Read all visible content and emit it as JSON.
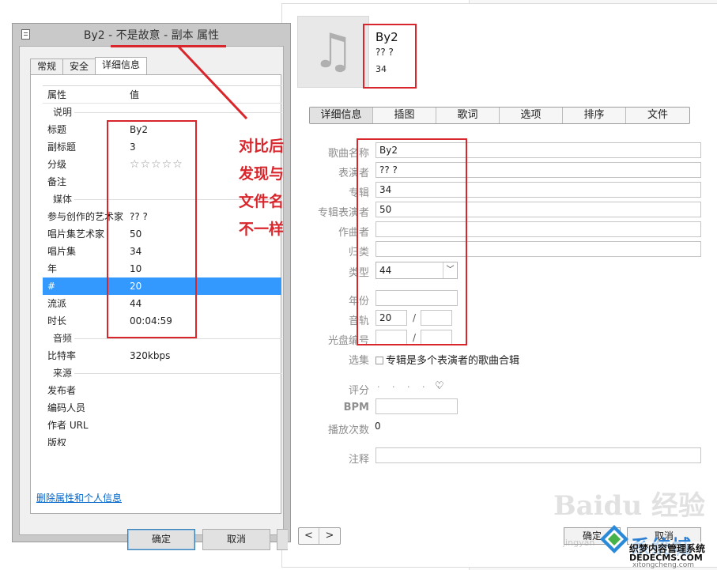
{
  "win": {
    "title": "By2 - 不是故意 - 副本 属性",
    "tabs": [
      "常规",
      "安全",
      "详细信息"
    ],
    "col_property": "属性",
    "col_value": "值",
    "sections": {
      "desc": "说明",
      "media": "媒体",
      "audio": "音频",
      "origin": "来源"
    },
    "rows": {
      "title": {
        "k": "标题",
        "v": "By2"
      },
      "subtitle": {
        "k": "副标题",
        "v": "3"
      },
      "rating": {
        "k": "分级",
        "v": "☆☆☆☆☆"
      },
      "comment": {
        "k": "备注",
        "v": ""
      },
      "contrib": {
        "k": "参与创作的艺术家",
        "v": "?? ?"
      },
      "album_artist": {
        "k": "唱片集艺术家",
        "v": "50"
      },
      "album": {
        "k": "唱片集",
        "v": "34"
      },
      "year": {
        "k": "年",
        "v": "10"
      },
      "track": {
        "k": "#",
        "v": "20"
      },
      "genre": {
        "k": "流派",
        "v": "44"
      },
      "length": {
        "k": "时长",
        "v": "00:04:59"
      },
      "bitrate": {
        "k": "比特率",
        "v": "320kbps"
      },
      "publisher": {
        "k": "发布者",
        "v": ""
      },
      "encoder": {
        "k": "编码人员",
        "v": ""
      },
      "author_url": {
        "k": "作者 URL",
        "v": ""
      },
      "copyright": {
        "k": "版权",
        "v": ""
      }
    },
    "remove_link": "删除属性和个人信息",
    "ok": "确定",
    "cancel": "取消"
  },
  "itunes": {
    "song_title": "By2",
    "song_artist": "?? ?",
    "song_album": "34",
    "tabs": [
      "详细信息",
      "插图",
      "歌词",
      "选项",
      "排序",
      "文件"
    ],
    "labels": {
      "name": "歌曲名称",
      "artist": "表演者",
      "album": "专辑",
      "album_artist": "专辑表演者",
      "composer": "作曲者",
      "grouping": "归类",
      "genre": "类型",
      "year": "年份",
      "track": "音轨",
      "disc": "光盘编号",
      "compilation": "选集",
      "rating": "评分",
      "bpm": "BPM",
      "play_count": "播放次数",
      "comments": "注释"
    },
    "values": {
      "name": "By2",
      "artist": "?? ?",
      "album": "34",
      "album_artist": "50",
      "composer": "",
      "grouping": "",
      "genre": "44",
      "year": "",
      "track": "20",
      "track_total": "",
      "disc": "",
      "disc_total": "",
      "bpm": "",
      "play_count": "0",
      "comments": ""
    },
    "compilation_label": "专辑是多个表演者的歌曲合辑",
    "rating_dots": "· · · · ·",
    "prev": "<",
    "next": ">",
    "ok": "确定",
    "cancel": "取消"
  },
  "annotation": {
    "lines": [
      "对比后",
      "发现与",
      "文件名",
      "不一样"
    ],
    "color": "#d9262c"
  },
  "watermarks": {
    "baidu": "Baidu 经验",
    "jingyan": "jingyan",
    "brand": "系统城",
    "brand2": "织梦内容管理系统",
    "site1": "DEDECMS.COM",
    "site2": "xitongcheng.com"
  }
}
